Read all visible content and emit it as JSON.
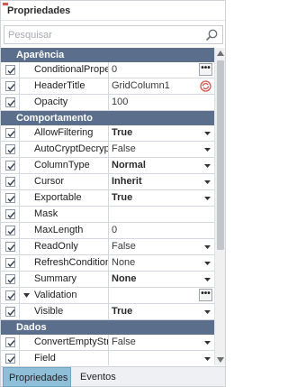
{
  "panel": {
    "title": "Propriedades"
  },
  "search": {
    "placeholder": "Pesquisar"
  },
  "categories": {
    "appearance": "Aparência",
    "behavior": "Comportamento",
    "data": "Dados"
  },
  "rows": {
    "conditional_properties": {
      "name": "ConditionalProperti",
      "value": "0"
    },
    "header_title": {
      "name": "HeaderTitle",
      "value": "GridColumn1"
    },
    "opacity": {
      "name": "Opacity",
      "value": "100"
    },
    "allow_filtering": {
      "name": "AllowFiltering",
      "value": "True"
    },
    "auto_crypt_decrypt": {
      "name": "AutoCryptDecrypt",
      "value": "False"
    },
    "column_type": {
      "name": "ColumnType",
      "value": "Normal"
    },
    "cursor": {
      "name": "Cursor",
      "value": "Inherit"
    },
    "exportable": {
      "name": "Exportable",
      "value": "True"
    },
    "mask": {
      "name": "Mask",
      "value": ""
    },
    "max_length": {
      "name": "MaxLength",
      "value": "0"
    },
    "read_only": {
      "name": "ReadOnly",
      "value": "False"
    },
    "refresh_conditional": {
      "name": "RefreshConditionalF",
      "value": "None"
    },
    "summary": {
      "name": "Summary",
      "value": "None"
    },
    "validation": {
      "name": "Validation",
      "value": ""
    },
    "visible": {
      "name": "Visible",
      "value": "True"
    },
    "convert_empty_string": {
      "name": "ConvertEmptyString",
      "value": "False"
    },
    "field": {
      "name": "Field",
      "value": ""
    }
  },
  "buttons": {
    "ellipsis": "•••"
  },
  "tabs": {
    "properties": "Propriedades",
    "events": "Eventos"
  },
  "colors": {
    "category_header": "#5b6f8c",
    "active_tab": "#8fbfd8",
    "reset_icon": "#d9534f"
  }
}
